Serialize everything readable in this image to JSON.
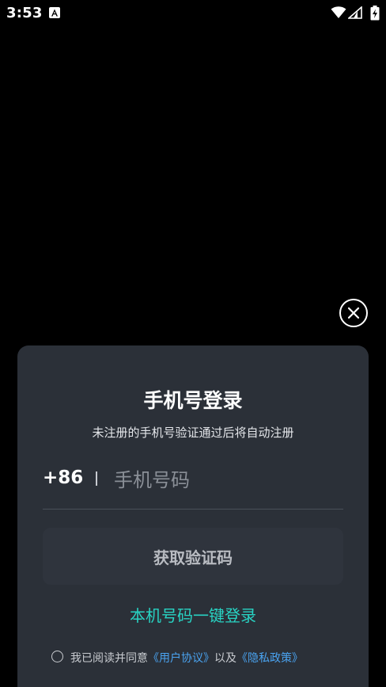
{
  "status_bar": {
    "time": "3:53",
    "notification_icon": "notification-a-icon",
    "wifi_icon": "wifi-icon",
    "signal_icon": "cellular-signal-icon",
    "battery_icon": "battery-charging-icon"
  },
  "close_button": {
    "icon": "close-icon"
  },
  "login_panel": {
    "title": "手机号登录",
    "subtitle": "未注册的手机号验证通过后将自动注册",
    "country_code": "+86",
    "phone_placeholder": "手机号码",
    "phone_value": "",
    "get_code_label": "获取验证码",
    "one_click_login_label": "本机号码一键登录",
    "agreement": {
      "prefix": "我已阅读并同意",
      "user_agreement": "《用户协议》",
      "conjunction": "以及",
      "privacy_policy": "《隐私政策》",
      "checked": false
    }
  },
  "colors": {
    "background": "#000000",
    "panel": "#2b3038",
    "button": "#2f343d",
    "accent": "#28d3c3",
    "link": "#4aa3f0"
  }
}
